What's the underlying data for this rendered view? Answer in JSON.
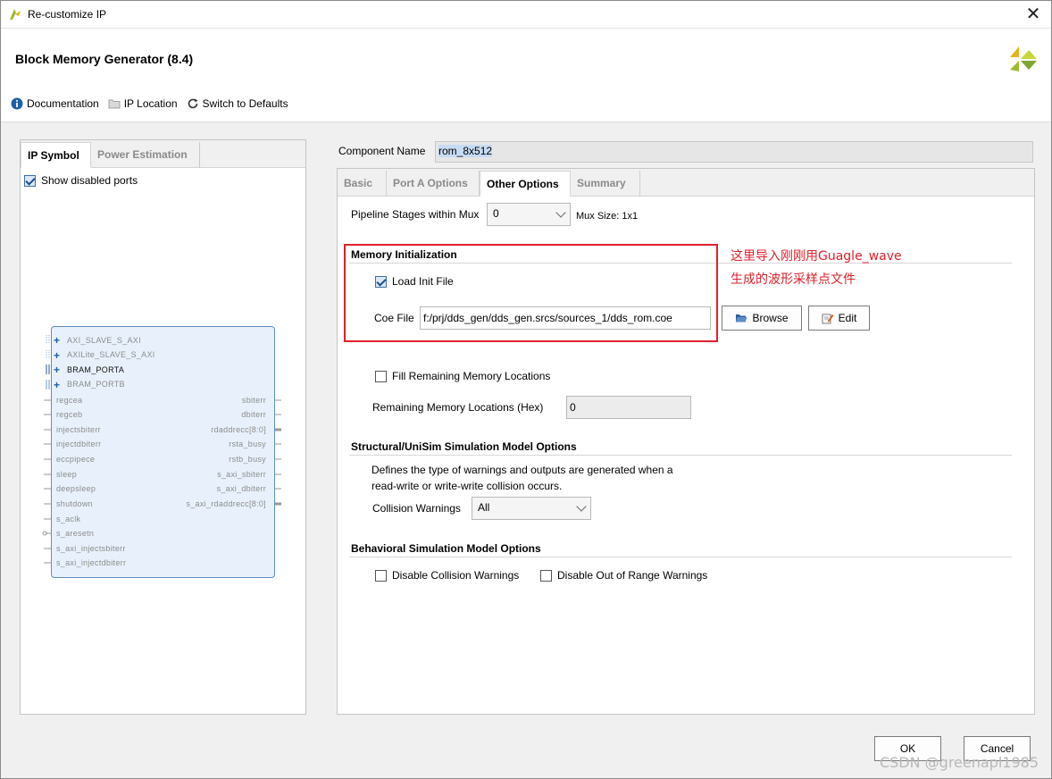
{
  "window": {
    "title": "Re-customize IP"
  },
  "header": {
    "title": "Block Memory Generator (8.4)",
    "toolbar": {
      "documentation": "Documentation",
      "ip_location": "IP Location",
      "switch_defaults": "Switch to Defaults"
    }
  },
  "left_panel": {
    "tabs": [
      "IP Symbol",
      "Power Estimation"
    ],
    "show_disabled_ports": "Show disabled ports",
    "symbol": {
      "buses": [
        "AXI_SLAVE_S_AXI",
        "AXILite_SLAVE_S_AXI",
        "BRAM_PORTA",
        "BRAM_PORTB"
      ],
      "left_ports": [
        "regcea",
        "regceb",
        "injectsbiterr",
        "injectdbiterr",
        "eccpipece",
        "sleep",
        "deepsleep",
        "shutdown",
        "s_aclk",
        "s_aresetn",
        "s_axi_injectsbiterr",
        "s_axi_injectdbiterr"
      ],
      "right_ports": [
        "sbiterr",
        "dbiterr",
        "rdaddrecc[8:0]",
        "rsta_busy",
        "rstb_busy",
        "s_axi_sbiterr",
        "s_axi_dbiterr",
        "s_axi_rdaddrecc[8:0]"
      ]
    }
  },
  "component": {
    "label": "Component Name",
    "value": "rom_8x512"
  },
  "tabs": [
    "Basic",
    "Port A Options",
    "Other Options",
    "Summary"
  ],
  "other_options": {
    "pipeline_label": "Pipeline Stages within Mux",
    "pipeline_value": "0",
    "mux_size": "Mux Size: 1x1",
    "mem_init_title": "Memory Initialization",
    "load_init_file": "Load Init File",
    "coe_label": "Coe File",
    "coe_value": "f:/prj/dds_gen/dds_gen.srcs/sources_1/dds_rom.coe",
    "browse": "Browse",
    "edit": "Edit",
    "fill_remaining": "Fill Remaining Memory Locations",
    "remaining_label": "Remaining Memory Locations (Hex)",
    "remaining_value": "0",
    "structural_title": "Structural/UniSim Simulation Model Options",
    "structural_desc_1": "Defines the type of warnings and outputs are generated when a",
    "structural_desc_2": "read-write or write-write collision occurs.",
    "collision_label": "Collision Warnings",
    "collision_value": "All",
    "behavioral_title": "Behavioral Simulation Model Options",
    "disable_collision": "Disable Collision Warnings",
    "disable_range": "Disable Out of Range Warnings"
  },
  "annotation": {
    "line1": "这里导入刚刚用Guagle_wave",
    "line2": "生成的波形采样点文件"
  },
  "footer": {
    "ok": "OK",
    "cancel": "Cancel"
  },
  "watermark": "CSDN @greenapl1985",
  "colors": {
    "accent": "#1f5ea8",
    "annotation": "#e0202a"
  }
}
